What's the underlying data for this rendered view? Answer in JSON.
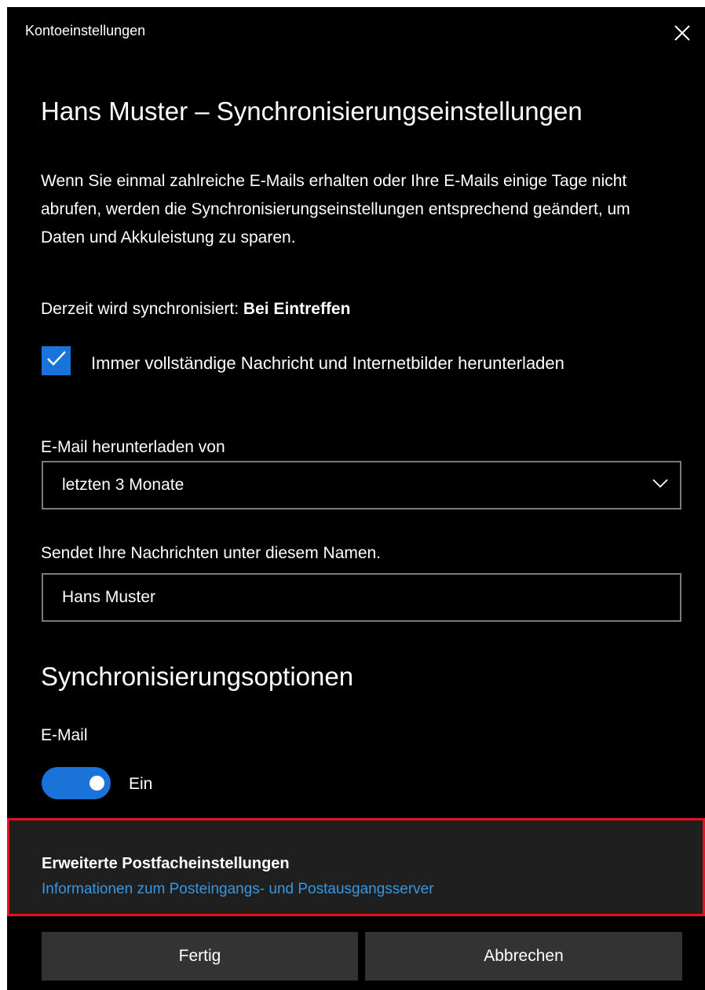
{
  "window": {
    "title": "Kontoeinstellungen"
  },
  "sync_settings": {
    "heading": "Hans Muster – Synchronisierungseinstellungen",
    "description": "Wenn Sie einmal zahlreiche E-Mails erhalten oder Ihre E-Mails einige Tage nicht abrufen, werden die Synchronisierungseinstellungen entsprechend geändert, um Daten und Akkuleistung zu sparen.",
    "current_sync_label": "Derzeit wird synchronisiert:",
    "current_sync_value": "Bei Eintreffen",
    "download_full_checkbox": {
      "label": "Immer vollständige Nachricht und Internetbilder herunterladen",
      "checked": true
    },
    "download_from": {
      "label": "E-Mail herunterladen von",
      "selected": "letzten 3 Monate"
    },
    "sender_name": {
      "label": "Sendet Ihre Nachrichten unter diesem Namen.",
      "value": "Hans Muster"
    }
  },
  "sync_options": {
    "title": "Synchronisierungsoptionen",
    "email_label": "E-Mail",
    "email_toggle_state": "Ein",
    "email_toggle_on": true
  },
  "advanced": {
    "title": "Erweiterte Postfacheinstellungen",
    "link": "Informationen zum Posteingangs- und Postausgangsserver"
  },
  "buttons": {
    "done": "Fertig",
    "cancel": "Abbrechen"
  },
  "colors": {
    "background": "#000000",
    "accent": "#1a73d9",
    "link": "#3a96dd",
    "highlight_border": "#e81123",
    "button": "#333333",
    "panel": "#1f1f1f"
  },
  "icons": {
    "close": "close-icon",
    "check": "checkmark-icon",
    "dropdown": "chevron-down-icon"
  }
}
